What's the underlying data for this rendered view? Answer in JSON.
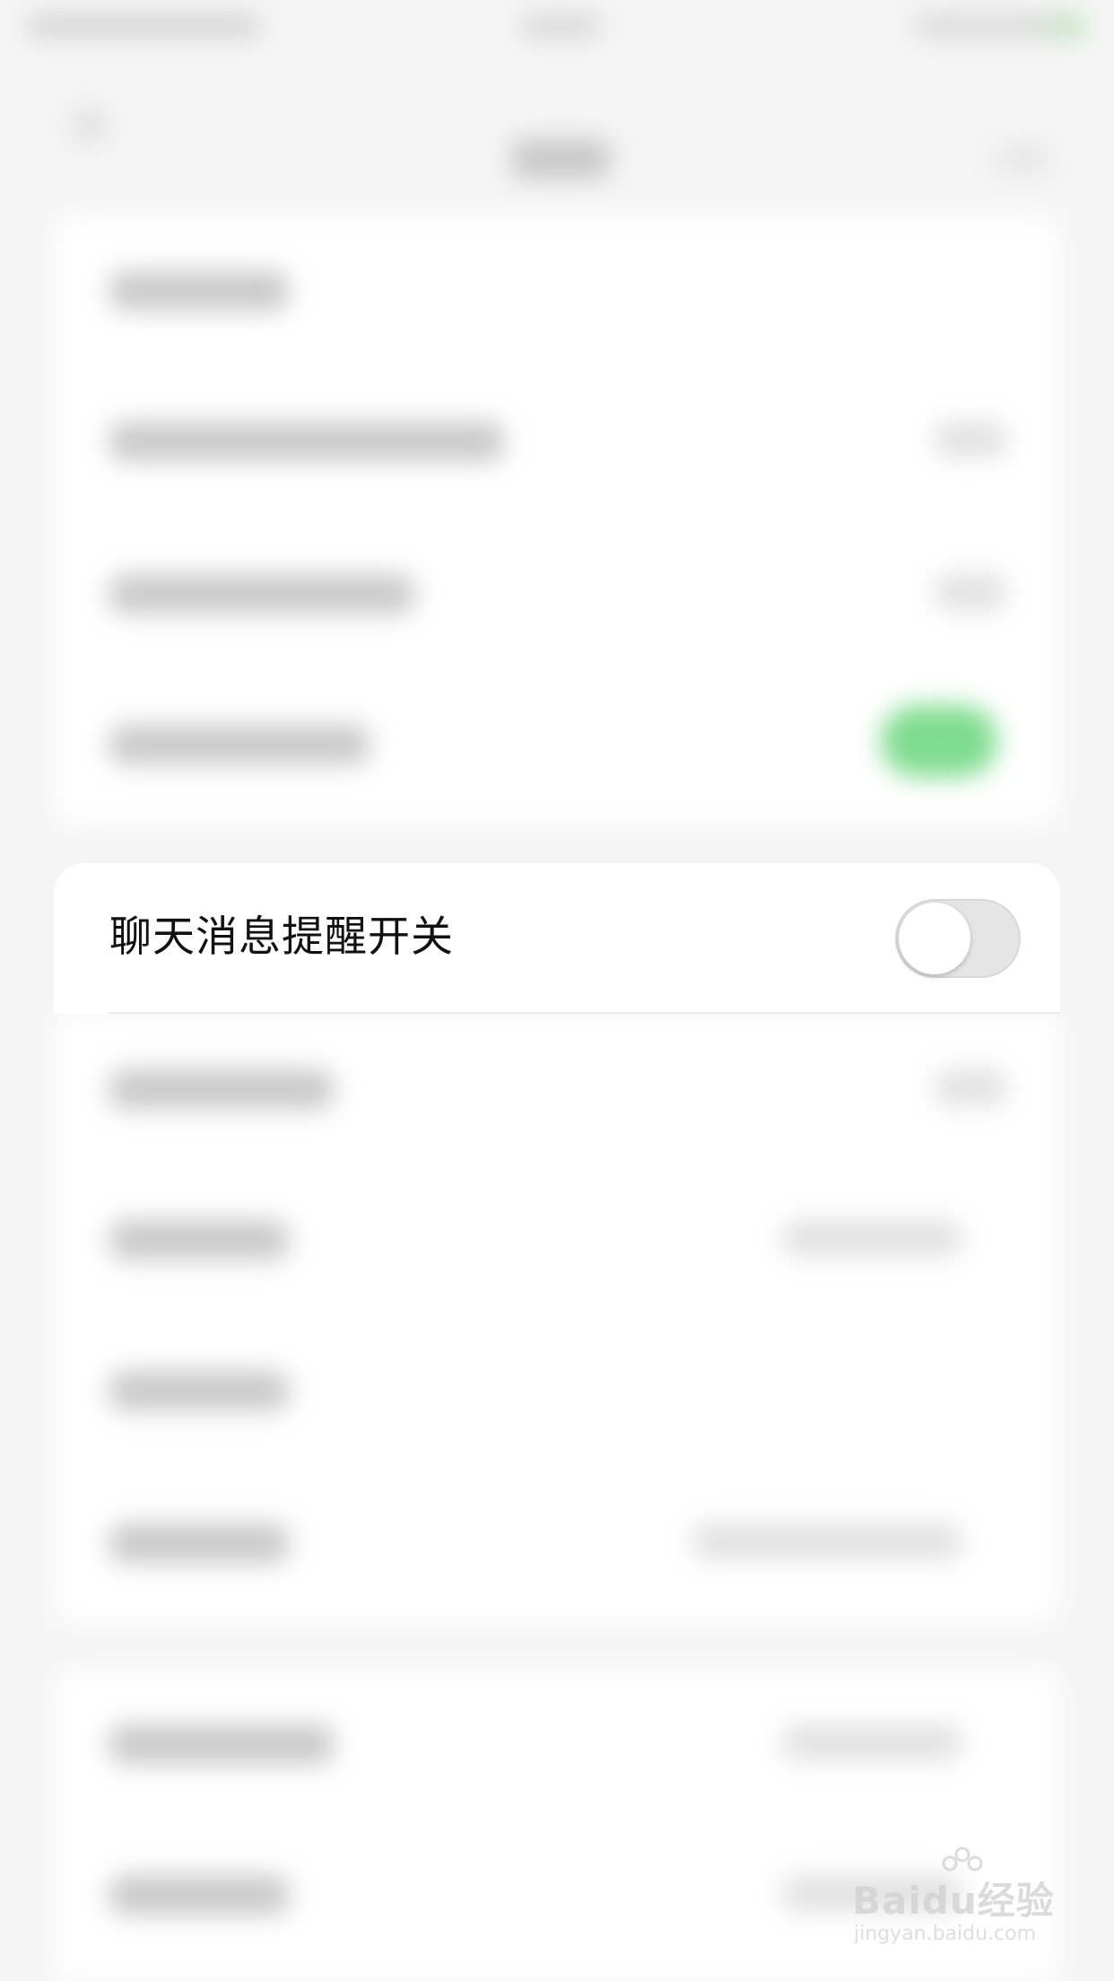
{
  "focused_setting": {
    "label": "聊天消息提醒开关",
    "toggle_state": "off"
  },
  "watermark": {
    "brand": "Baidu经验",
    "url": "jingyan.baidu.com"
  },
  "colors": {
    "toggle_on": "#7fdc8f",
    "toggle_off": "#e5e5e5",
    "background": "#f5f5f5",
    "card": "#ffffff"
  }
}
